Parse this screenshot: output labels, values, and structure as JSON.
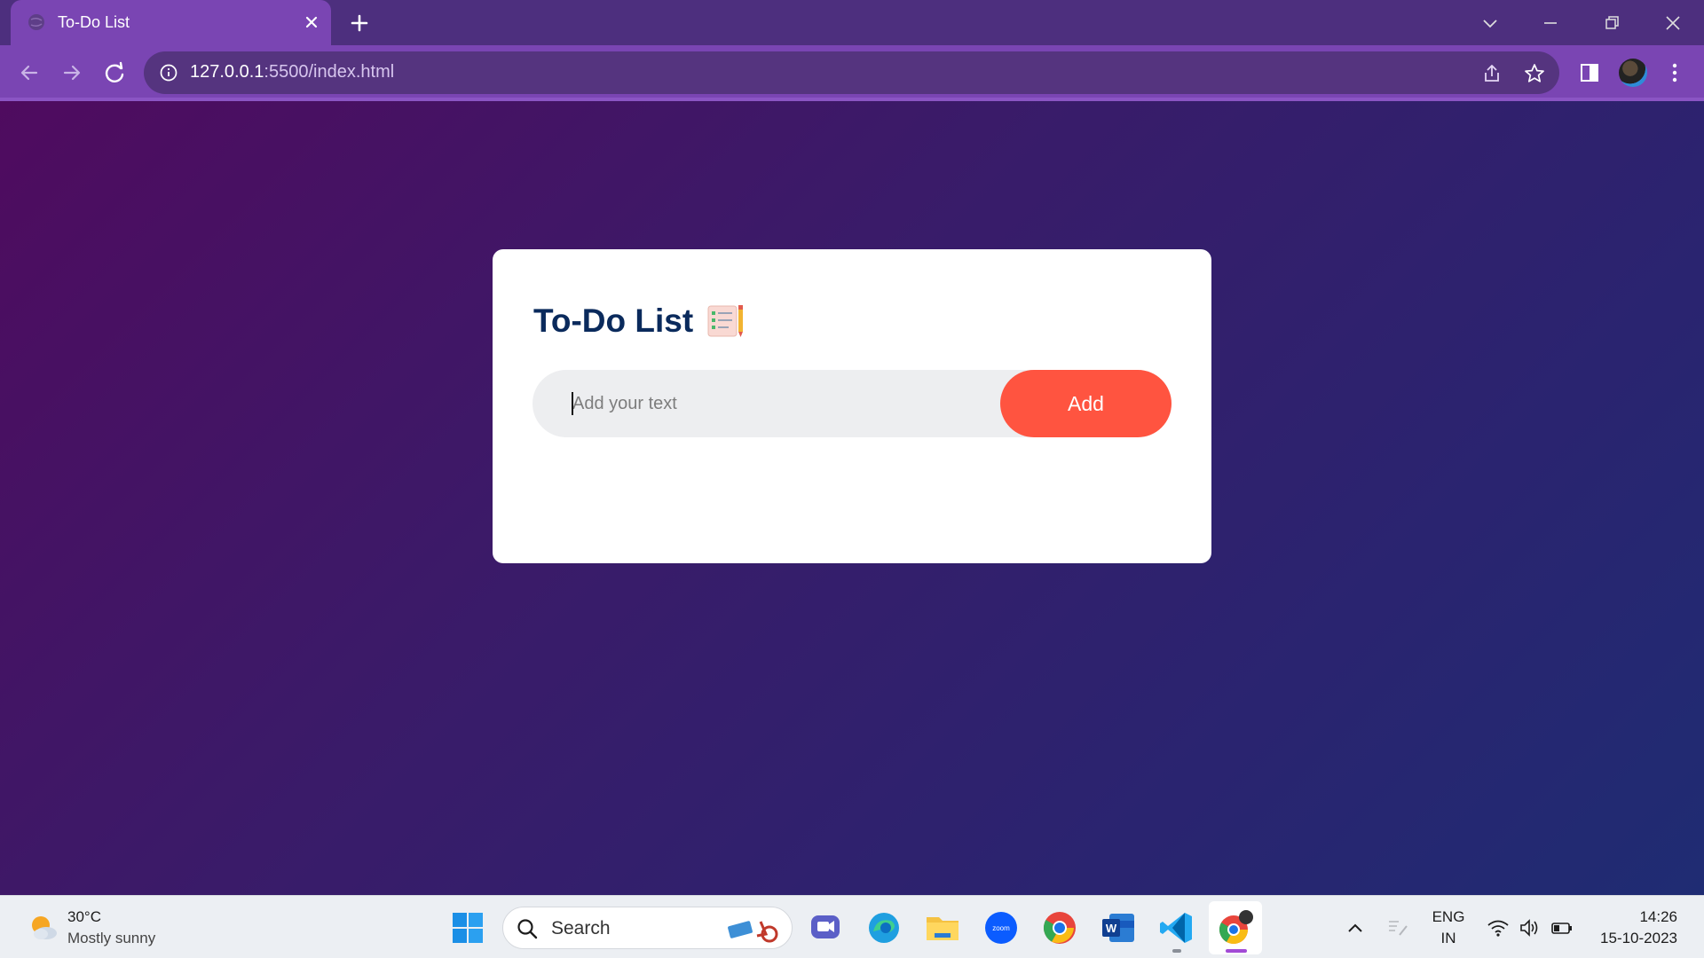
{
  "browser": {
    "tab_title": "To-Do List",
    "url_host": "127.0.0.1",
    "url_rest": ":5500/index.html"
  },
  "app": {
    "title": "To-Do List",
    "input_placeholder": "Add your text",
    "add_label": "Add"
  },
  "taskbar": {
    "weather_temp": "30°C",
    "weather_desc": "Mostly sunny",
    "search_placeholder": "Search",
    "lang_top": "ENG",
    "lang_bottom": "IN",
    "time": "14:26",
    "date": "15-10-2023"
  },
  "colors": {
    "accent": "#ff5440",
    "title": "#0a2a5c",
    "chrome": "#7a45b3"
  }
}
